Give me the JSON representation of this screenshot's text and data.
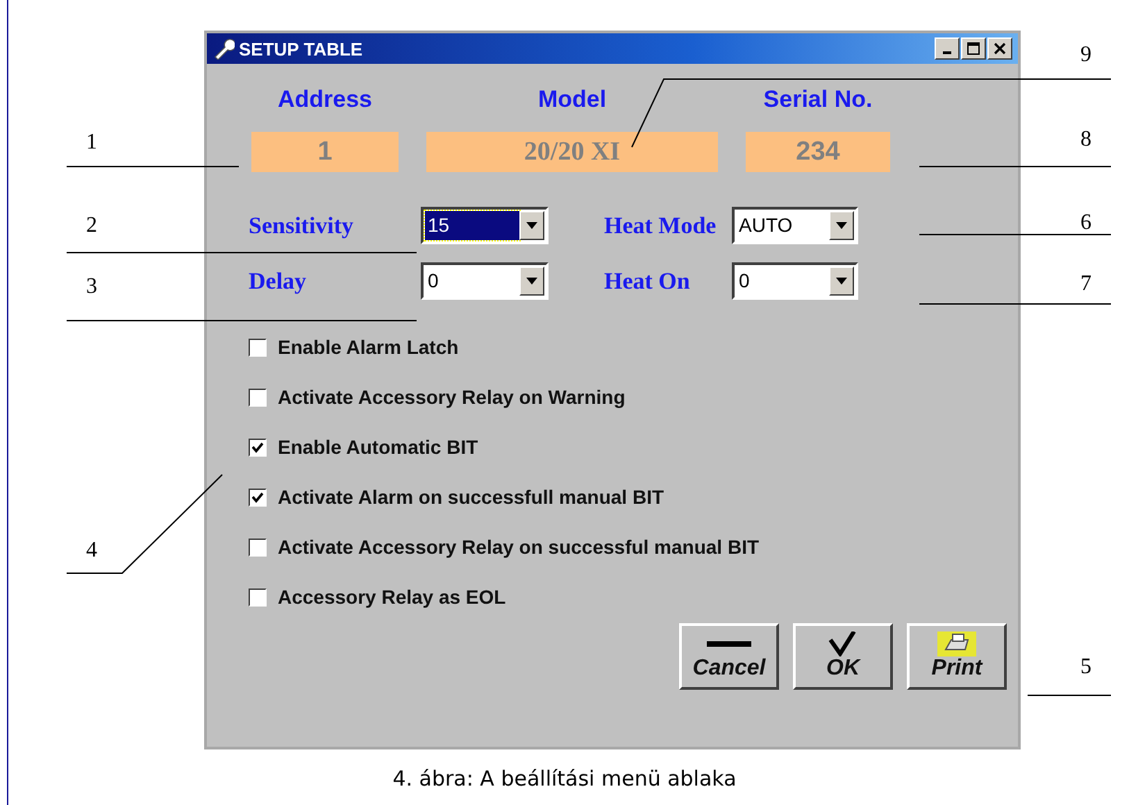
{
  "window": {
    "title": "SETUP TABLE"
  },
  "fields": [
    {
      "label": "Address",
      "value": "1"
    },
    {
      "label": "Model",
      "value": "20/20 XI"
    },
    {
      "label": "Serial No.",
      "value": "234"
    }
  ],
  "dropdowns": [
    {
      "label": "Sensitivity",
      "value": "15",
      "focused": true
    },
    {
      "label": "Heat Mode",
      "value": "AUTO",
      "focused": false
    },
    {
      "label": "Delay",
      "value": "0",
      "focused": false
    },
    {
      "label": "Heat On",
      "value": "0",
      "focused": false
    }
  ],
  "options": [
    {
      "label": "Enable Alarm Latch",
      "checked": false
    },
    {
      "label": "Activate Accessory Relay on Warning",
      "checked": false
    },
    {
      "label": "Enable Automatic BIT",
      "checked": true
    },
    {
      "label": "Activate Alarm on successfull manual BIT",
      "checked": true
    },
    {
      "label": "Activate Accessory Relay on successful manual BIT",
      "checked": false
    },
    {
      "label": "Accessory Relay as EOL",
      "checked": false
    }
  ],
  "buttons": [
    {
      "kind": "cancel",
      "label": "Cancel"
    },
    {
      "kind": "ok",
      "label": "OK"
    },
    {
      "kind": "print",
      "label": "Print"
    }
  ],
  "callouts": [
    {
      "label": "9"
    },
    {
      "label": "1"
    },
    {
      "label": "8"
    },
    {
      "label": "2"
    },
    {
      "label": "6"
    },
    {
      "label": "3"
    },
    {
      "label": "7"
    },
    {
      "label": "4"
    },
    {
      "label": "5"
    }
  ],
  "caption": "4. ábra: A beállítási menü ablaka"
}
